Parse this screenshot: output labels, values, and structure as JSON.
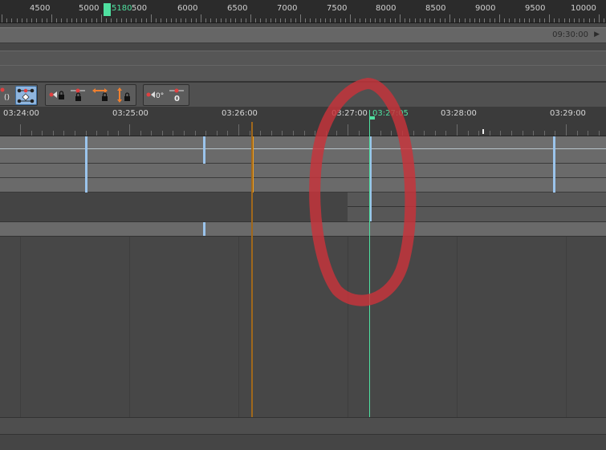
{
  "frame_ruler": {
    "labels": [
      "4500",
      "5000",
      "5180",
      "500",
      "6000",
      "6500",
      "7000",
      "7500",
      "8000",
      "8500",
      "9000",
      "9500",
      "10000"
    ],
    "current_frame": "5180"
  },
  "time_bar": {
    "value": "09:30:00",
    "arrow": "▶"
  },
  "time_ruler": {
    "labels": [
      "03:24:00",
      "03:25:00",
      "03:26:00",
      "03:27:00",
      "03:28:00",
      "03:29:00"
    ],
    "current": "03:27:05"
  },
  "toolbar": {
    "rotation_value": "0°",
    "zero_value": "0"
  },
  "colors": {
    "accent_green": "#4fe0a0",
    "key_blue": "#9bc4ec",
    "key_orange": "#f0a020",
    "annotation_red": "#c8333b"
  }
}
